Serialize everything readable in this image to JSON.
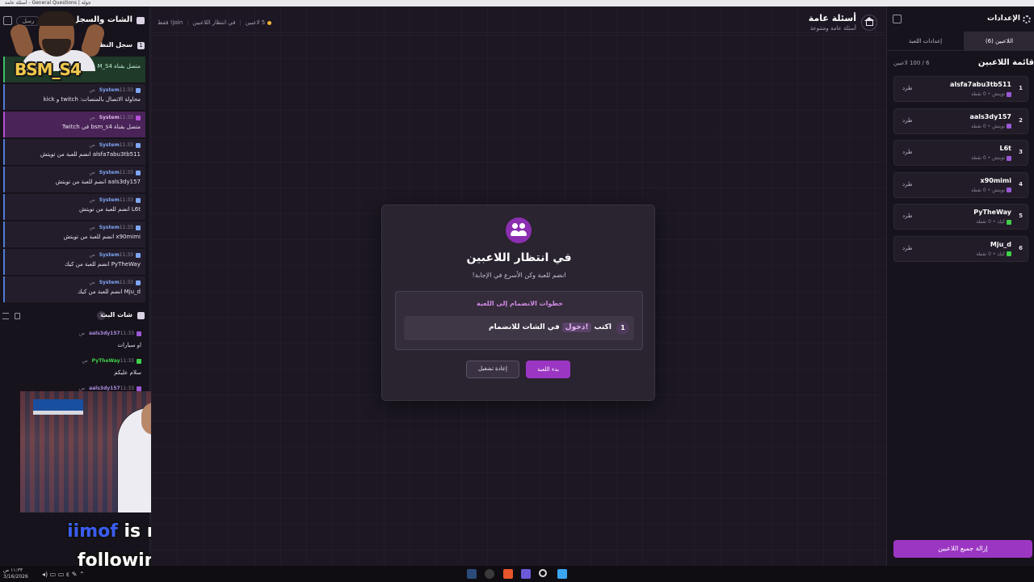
{
  "browser": {
    "title": "أسئلة عامة - General Questions | جولة"
  },
  "left": {
    "header_title": "الشات والسجل",
    "pill_label": "رسل",
    "log_title": "سجل النظام",
    "log_count": "1",
    "log": [
      {
        "type": "green",
        "sender": "",
        "time": "",
        "message": "متصل بقناة M_S4"
      },
      {
        "type": "blue",
        "sender": "System",
        "time": "11:33 ص",
        "message": "محاولة الاتصال بالمنصات: twitch و kick"
      },
      {
        "type": "purple",
        "sender": "System",
        "time": "11:33 ص",
        "message": "متصل بقناة bsm_s4 في Twitch"
      },
      {
        "type": "blue",
        "sender": "System",
        "time": "11:33 ص",
        "message": "alsfa7abu3tb511 انضم للعبة من تويتش"
      },
      {
        "type": "blue",
        "sender": "System",
        "time": "11:33 ص",
        "message": "aals3dy157 انضم للعبة من تويتش"
      },
      {
        "type": "blue",
        "sender": "System",
        "time": "11:33 ص",
        "message": "L6t انضم للعبة من تويتش"
      },
      {
        "type": "blue",
        "sender": "System",
        "time": "11:33 ص",
        "message": "x90mimi انضم للعبة من تويتش"
      },
      {
        "type": "blue",
        "sender": "System",
        "time": "11:33 ص",
        "message": "PyTheWay انضم للعبة من كيك"
      },
      {
        "type": "blue",
        "sender": "System",
        "time": "11:33 ص",
        "message": "Mju_d انضم للعبة من كيك"
      }
    ],
    "chat_title": "شات البث",
    "chat_count": "3",
    "chat": [
      {
        "user": "aals3dy157",
        "platform": "twitch",
        "time": "11:33 ص",
        "text": "او سيارات"
      },
      {
        "user": "PyTheWay",
        "platform": "kick",
        "time": "11:33 ص",
        "text": "سلام عليكم"
      },
      {
        "user": "aals3dy157",
        "platform": "twitch",
        "time": "11:33 ص",
        "text": ""
      }
    ]
  },
  "overlay": {
    "streamer_tag": "BSM_S4",
    "video_logo": "bein",
    "follow_user": "iimof",
    "follow_text": " is now following!"
  },
  "main": {
    "title": "أسئلة عامة",
    "subtitle": "أسئلة عامة ومتنوعة",
    "status_players": "5 لاعبين",
    "status_waiting": "في انتظار اللاعبين",
    "status_join": "join! فقط"
  },
  "modal": {
    "title": "في انتظار اللاعبين",
    "subtitle": "انضم للعبة وكن الأسرع في الإجابة!",
    "steps_title": "خطوات الانضمام إلى اللعبة",
    "step_num": "1",
    "step_prefix": "اكتب",
    "step_keyword": "!دخول",
    "step_suffix": "في الشات للانضمام",
    "start_button": "بدء اللعبة",
    "restart_button": "إعادة تشغيل"
  },
  "right": {
    "header_title": "الإعدادات",
    "tab_players": "اللاعبين (6)",
    "tab_settings": "إعدادات اللعبة",
    "list_title": "قائمة اللاعبين",
    "list_count": "6 / 100 لاعبين",
    "kick_label": "طرد",
    "remove_all": "إزالة جميع اللاعبين",
    "players": [
      {
        "idx": "1",
        "name": "alsfa7abu3tb511",
        "platform": "twitch",
        "platform_label": "تويتش",
        "points": "0 نقطة"
      },
      {
        "idx": "2",
        "name": "aals3dy157",
        "platform": "twitch",
        "platform_label": "تويتش",
        "points": "0 نقطة"
      },
      {
        "idx": "3",
        "name": "L6t",
        "platform": "twitch",
        "platform_label": "تويتش",
        "points": "0 نقطة"
      },
      {
        "idx": "4",
        "name": "x90mimi",
        "platform": "twitch",
        "platform_label": "تويتش",
        "points": "0 نقطة"
      },
      {
        "idx": "5",
        "name": "PyTheWay",
        "platform": "kick",
        "platform_label": "كيك",
        "points": "0 نقطة"
      },
      {
        "idx": "6",
        "name": "Mju_d",
        "platform": "kick",
        "platform_label": "كيك",
        "points": "0 نقطة"
      }
    ]
  },
  "taskbar": {
    "time": "١١:٣٣ ص",
    "date": "3/16/2026"
  },
  "colors": {
    "accent": "#9b36c2",
    "twitch": "#9b59d6",
    "kick": "#3fcf4a",
    "system": "#7fa6f5"
  }
}
